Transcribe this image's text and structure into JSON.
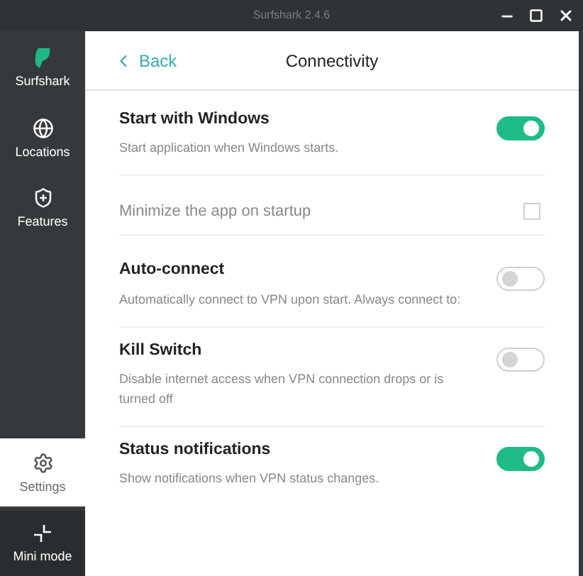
{
  "window": {
    "title": "Surfshark 2.4.6"
  },
  "sidebar": {
    "items": [
      {
        "label": "Surfshark",
        "kind": "logo",
        "selected": false
      },
      {
        "label": "Locations",
        "kind": "globe",
        "selected": false
      },
      {
        "label": "Features",
        "kind": "shield",
        "selected": false
      },
      {
        "label": "Settings",
        "kind": "gear",
        "selected": true
      },
      {
        "label": "Mini mode",
        "kind": "mini",
        "selected": false
      }
    ]
  },
  "header": {
    "back": "Back",
    "title": "Connectivity"
  },
  "settings": [
    {
      "kind": "toggle",
      "title": "Start with Windows",
      "description": "Start application when Windows starts.",
      "on": true
    },
    {
      "kind": "checkbox",
      "title": "Minimize the app on startup",
      "checked": false
    },
    {
      "kind": "toggle",
      "title": "Auto-connect",
      "description": "Automatically connect to VPN upon start. Always connect to:",
      "on": false
    },
    {
      "kind": "toggle",
      "title": "Kill Switch",
      "description": "Disable internet access when VPN connection drops or is turned off",
      "on": false
    },
    {
      "kind": "toggle",
      "title": "Status notifications",
      "description": "Show notifications when VPN status changes.",
      "on": true
    }
  ]
}
